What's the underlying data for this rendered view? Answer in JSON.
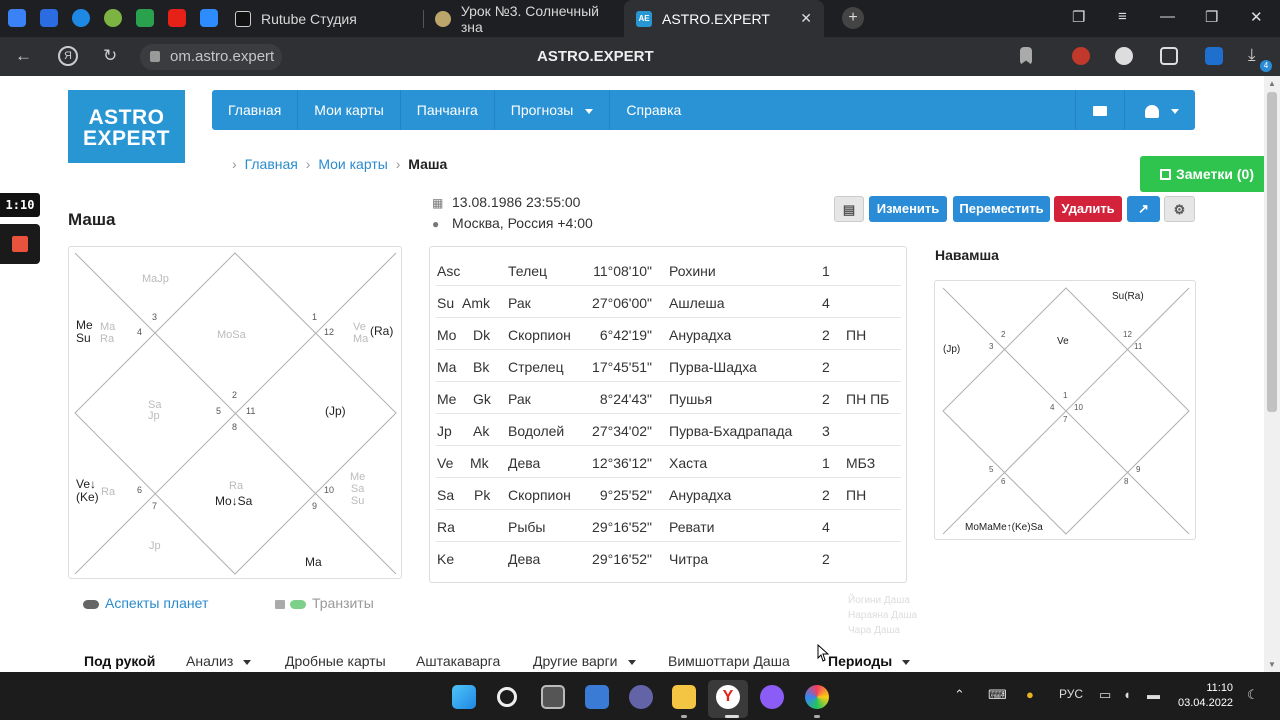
{
  "browser": {
    "tabs": [
      {
        "title": "Rutube Студия"
      },
      {
        "title": "Урок №3. Солнечный зна"
      },
      {
        "title": "ASTRO.EXPERT"
      }
    ],
    "url": "om.astro.expert",
    "page_title": "ASTRO.EXPERT",
    "download_badge": "4"
  },
  "site": {
    "logo_line1": "ASTRO",
    "logo_line2": "EXPERT",
    "nav": [
      "Главная",
      "Мои карты",
      "Панчанга",
      "Прогнозы",
      "Справка"
    ],
    "breadcrumb": [
      "Главная",
      "Мои карты",
      "Маша"
    ],
    "notes_label": "Заметки (0)"
  },
  "chart": {
    "name": "Маша",
    "datetime": "13.08.1986 23:55:00",
    "place": "Москва, Россия +4:00",
    "buttons": {
      "edit": "Изменить",
      "move": "Переместить",
      "delete": "Удалить"
    },
    "colors": {
      "blue": "#2a8bd6",
      "red": "#d2233a",
      "green": "#2fc44e"
    }
  },
  "rasi": {
    "labels": {
      "h12_ghost": "MaJp",
      "h4_main": "Me\nSu",
      "h4_ghost": "Ma\nRa",
      "h1_ghost": "MoSa",
      "h2_main": "(Ra)",
      "h2_ghost": "Ve\nMa",
      "center_ghost": "Sa\nJp",
      "h10_main": "(Jp)",
      "h7_main": "Ve↓\n(Ke)",
      "h7_ghost": "Ra",
      "h8_ghost": "Ra",
      "h8_main": "Mo↓Sa",
      "h9_ghost": "Me\nSa\nSu",
      "bottom_ghost": "Jp",
      "bottom_main": "Ma"
    },
    "house_numbers": [
      "3",
      "4",
      "1",
      "12",
      "2",
      "5",
      "11",
      "8",
      "6",
      "7",
      "10",
      "9"
    ]
  },
  "planets": [
    {
      "p": "Asc",
      "k": "",
      "sign": "Телец",
      "deg": "11°08'10\"",
      "nak": "Рохини",
      "pada": "1",
      "note": ""
    },
    {
      "p": "Su",
      "k": "Amk",
      "sign": "Рак",
      "deg": "27°06'00\"",
      "nak": "Ашлеша",
      "pada": "4",
      "note": ""
    },
    {
      "p": "Mo",
      "k": "Dk",
      "sign": "Скорпион",
      "deg": "6°42'19\"",
      "nak": "Анурадха",
      "pada": "2",
      "note": "ПН"
    },
    {
      "p": "Ma",
      "k": "Bk",
      "sign": "Стрелец",
      "deg": "17°45'51\"",
      "nak": "Пурва-Шадха",
      "pada": "2",
      "note": ""
    },
    {
      "p": "Me",
      "k": "Gk",
      "sign": "Рак",
      "deg": "8°24'43\"",
      "nak": "Пушья",
      "pada": "2",
      "note": "ПН ПБ"
    },
    {
      "p": "Jp",
      "k": "Ak",
      "sign": "Водолей",
      "deg": "27°34'02\"",
      "nak": "Пурва-Бхадрапада",
      "pada": "3",
      "note": ""
    },
    {
      "p": "Ve",
      "k": "Mk",
      "sign": "Дева",
      "deg": "12°36'12\"",
      "nak": "Хаста",
      "pada": "1",
      "note": "МБЗ"
    },
    {
      "p": "Sa",
      "k": "Pk",
      "sign": "Скорпион",
      "deg": "9°25'52\"",
      "nak": "Анурадха",
      "pada": "2",
      "note": "ПН"
    },
    {
      "p": "Ra",
      "k": "",
      "sign": "Рыбы",
      "deg": "29°16'52\"",
      "nak": "Ревати",
      "pada": "4",
      "note": ""
    },
    {
      "p": "Ke",
      "k": "",
      "sign": "Дева",
      "deg": "29°16'52\"",
      "nak": "Читра",
      "pada": "2",
      "note": ""
    }
  ],
  "navamsha": {
    "title": "Навамша",
    "labels": {
      "top": "Su(Ra)",
      "left": "(Jp)",
      "h1": "Ve",
      "bottom": "MoMaMe↑(Ke)Sa"
    },
    "house_numbers": [
      "2",
      "3",
      "12",
      "11",
      "1",
      "4",
      "10",
      "7",
      "5",
      "6",
      "9",
      "8"
    ]
  },
  "toggles": {
    "aspects": "Аспекты планет",
    "transits": "Транзиты"
  },
  "ghost_menu": [
    "Йогини Даша",
    "Нараяна Даша",
    "Чара Даша"
  ],
  "subnav": [
    "Под рукой",
    "Анализ",
    "Дробные карты",
    "Аштакаварга",
    "Другие варги",
    "Вимшоттари Даша",
    "Периоды"
  ],
  "recorder": {
    "time": "1:10"
  },
  "taskbar": {
    "lang": "РУС",
    "time": "11:10",
    "date": "03.04.2022"
  }
}
